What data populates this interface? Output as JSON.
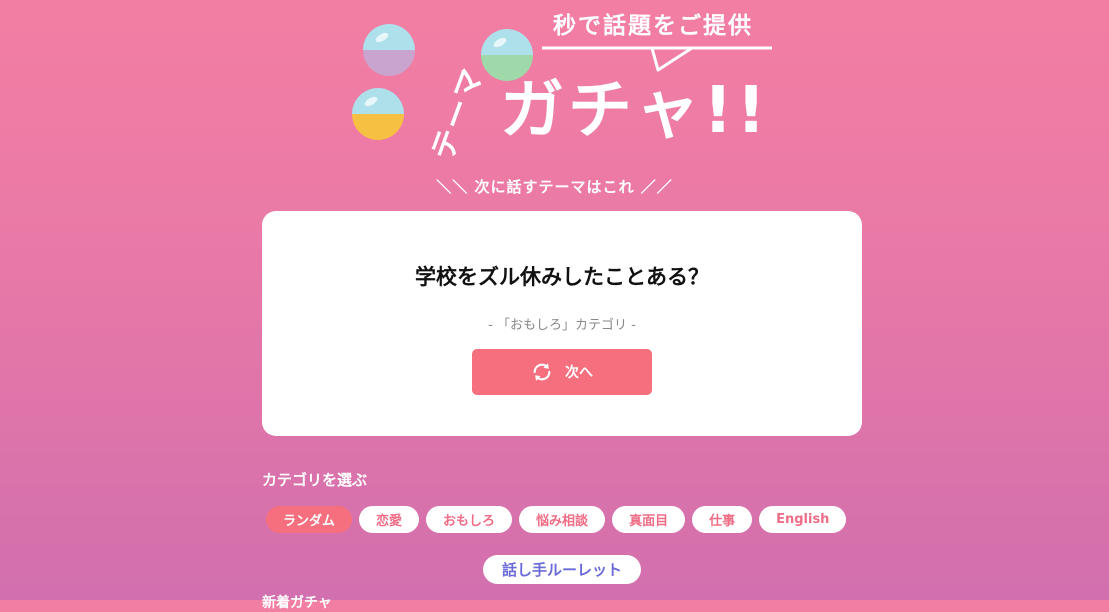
{
  "logo": {
    "tagline": "秒で話題をご提供",
    "theme_word": "テーマ",
    "gacha_word": "ガチャ!!"
  },
  "subhead": "＼＼ 次に話すテーマはこれ ／／",
  "card": {
    "question": "学校をズル休みしたことある？",
    "category_note": "- 「おもしろ」カテゴリ -",
    "next_label": "次へ"
  },
  "category_section": {
    "title": "カテゴリを選ぶ",
    "chips": [
      "ランダム",
      "恋愛",
      "おもしろ",
      "悩み相談",
      "真面目",
      "仕事",
      "English"
    ],
    "active_index": 0
  },
  "roulette_label": "話し手ルーレット",
  "cutoff_heading": "新着ガチャ",
  "colors": {
    "accent": "#f56f7e",
    "roulette_text": "#6a6ad8",
    "bg_top": "#f37ea3",
    "bg_bottom": "#d26fae"
  }
}
